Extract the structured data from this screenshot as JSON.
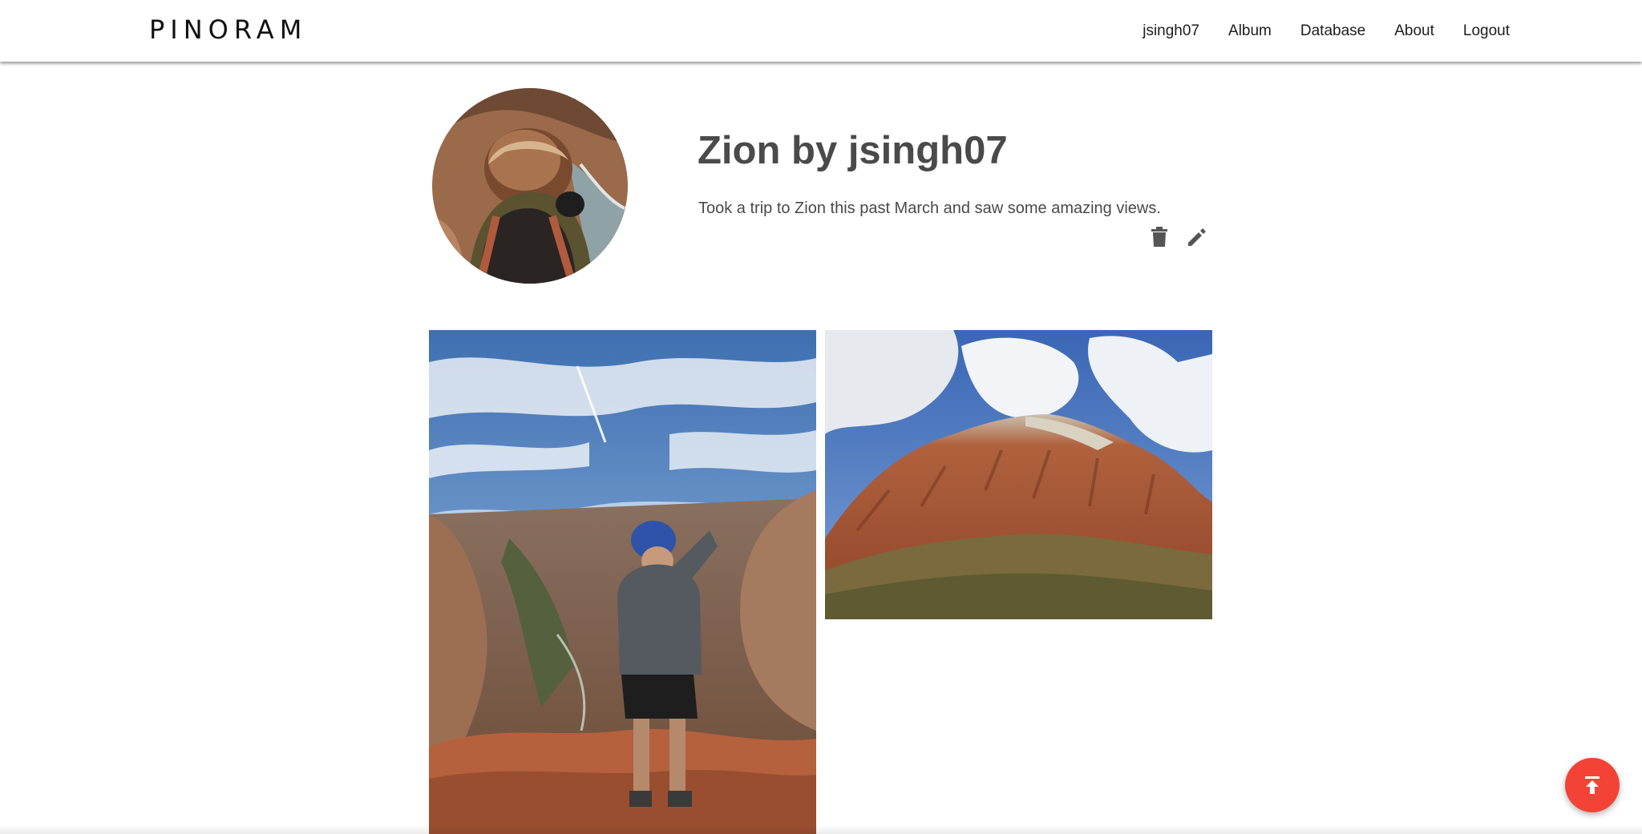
{
  "navbar": {
    "brand": "PINORAM",
    "links": [
      "jsingh07",
      "Album",
      "Database",
      "About",
      "Logout"
    ]
  },
  "album": {
    "title": "Zion by jsingh07",
    "description": "Took a trip to Zion this past March and saw some amazing views."
  },
  "icons": {
    "delete": "trash-icon",
    "edit": "pencil-icon",
    "scroll_top": "arrow-to-top-icon"
  },
  "colors": {
    "fab": "#f44336",
    "text": "#4a4a4a",
    "icon": "#555555"
  }
}
